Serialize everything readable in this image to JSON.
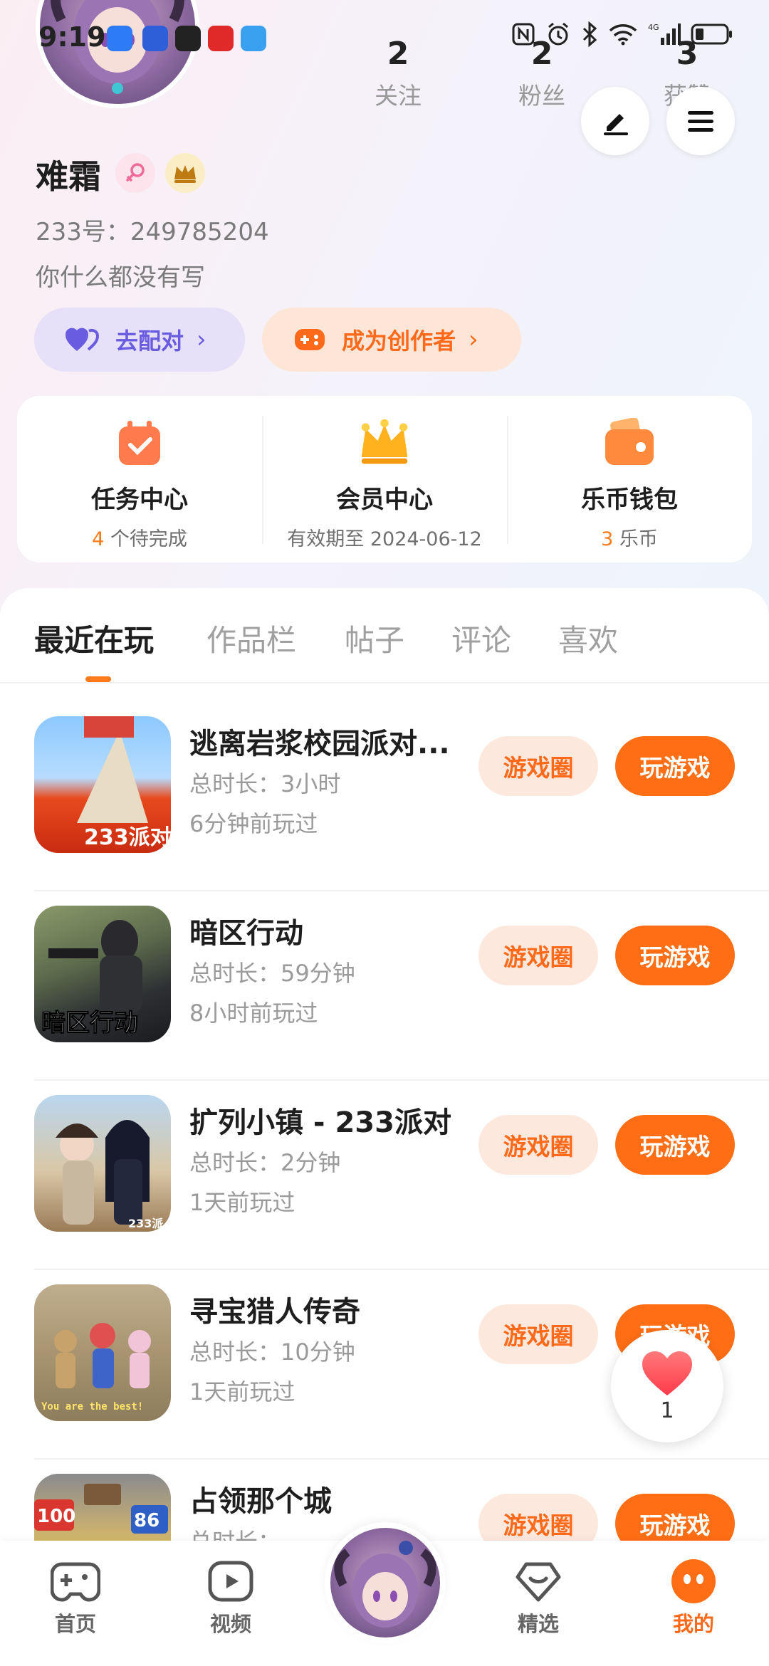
{
  "status_bar": {
    "time": "9:19",
    "app_icons": [
      "shield-app-icon",
      "tieba-app-icon",
      "qq-app-icon",
      "huawei-app-icon",
      "weather-app-icon"
    ],
    "right_icons": [
      "nfc-icon",
      "alarm-icon",
      "bluetooth-icon",
      "wifi-icon",
      "signal-4g-icon",
      "battery-icon"
    ]
  },
  "profile": {
    "stats": [
      {
        "count": "2",
        "label": "关注"
      },
      {
        "count": "2",
        "label": "粉丝"
      },
      {
        "count": "3",
        "label": "获赞"
      }
    ],
    "username": "难霜",
    "uid": "233号：249785204",
    "bio": "你什么都没有写",
    "pair_button": "去配对",
    "creator_button": "成为创作者"
  },
  "center_card": [
    {
      "title": "任务中心",
      "highlight": "4",
      "subtitle": " 个待完成"
    },
    {
      "title": "会员中心",
      "highlight": "",
      "subtitle": "有效期至 2024-06-12"
    },
    {
      "title": "乐币钱包",
      "highlight": "3",
      "subtitle": " 乐币"
    }
  ],
  "tabs": [
    "最近在玩",
    "作品栏",
    "帖子",
    "评论",
    "喜欢"
  ],
  "games": [
    {
      "name": "逃离岩浆校园派对...",
      "duration": "总时长：3小时",
      "last_played": "6分钟前玩过",
      "thumb_text": "233派对",
      "circle_label": "游戏圈",
      "play_label": "玩游戏"
    },
    {
      "name": "暗区行动",
      "duration": "总时长：59分钟",
      "last_played": "8小时前玩过",
      "thumb_text": "暗区行动",
      "circle_label": "游戏圈",
      "play_label": "玩游戏"
    },
    {
      "name": "扩列小镇 - 233派对",
      "duration": "总时长：2分钟",
      "last_played": "1天前玩过",
      "thumb_text": "233派",
      "circle_label": "游戏圈",
      "play_label": "玩游戏"
    },
    {
      "name": "寻宝猎人传奇",
      "duration": "总时长：10分钟",
      "last_played": "1天前玩过",
      "thumb_text": "You are the best!",
      "circle_label": "游戏圈",
      "play_label": "玩游戏"
    },
    {
      "name": "占领那个城",
      "duration": "总时长：",
      "last_played": "",
      "thumb_text": "100",
      "thumb_text_2": "86",
      "circle_label": "游戏圈",
      "play_label": "玩游戏"
    }
  ],
  "like_bubble": {
    "count": "1"
  },
  "bottom_nav": [
    {
      "label": "首页",
      "icon": "gamepad-icon"
    },
    {
      "label": "视频",
      "icon": "video-icon"
    },
    {
      "label": "",
      "icon": "avatar-center"
    },
    {
      "label": "精选",
      "icon": "heart-diamond-icon"
    },
    {
      "label": "我的",
      "icon": "mine-face-icon"
    }
  ],
  "colors": {
    "accent": "#ff6e14",
    "pair": "#6a5ce0",
    "muted": "#9a9a9a"
  }
}
